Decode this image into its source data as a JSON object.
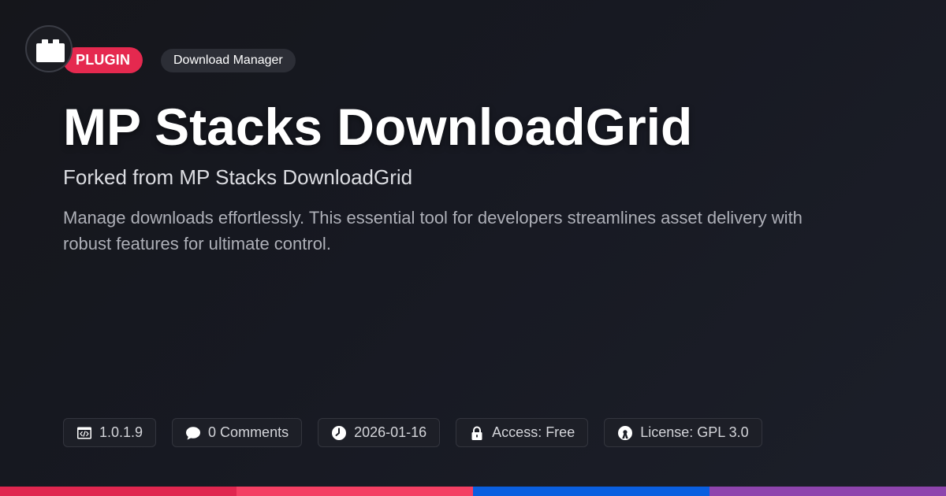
{
  "header": {
    "type_badge": "PLUGIN",
    "category_badge": "Download Manager",
    "logo_icon": "plugin-block-icon"
  },
  "main": {
    "title": "MP Stacks DownloadGrid",
    "subtitle": "Forked from MP Stacks DownloadGrid",
    "description": "Manage downloads effortlessly. This essential tool for developers streamlines asset delivery with robust features for ultimate control."
  },
  "meta": {
    "version": {
      "icon": "code-window-icon",
      "text": "1.0.1.9"
    },
    "comments": {
      "icon": "comment-bubble-icon",
      "text": "0 Comments"
    },
    "date": {
      "icon": "clock-icon",
      "text": "2026-01-16"
    },
    "access": {
      "icon": "lock-icon",
      "text": "Access: Free"
    },
    "license": {
      "icon": "open-source-icon",
      "text": "License: GPL 3.0"
    }
  },
  "colors": {
    "badge_plugin": "#e5294f",
    "bar_segments": [
      "#e0264f",
      "#f43f63",
      "#0a5fe0",
      "#8e44ad"
    ]
  }
}
